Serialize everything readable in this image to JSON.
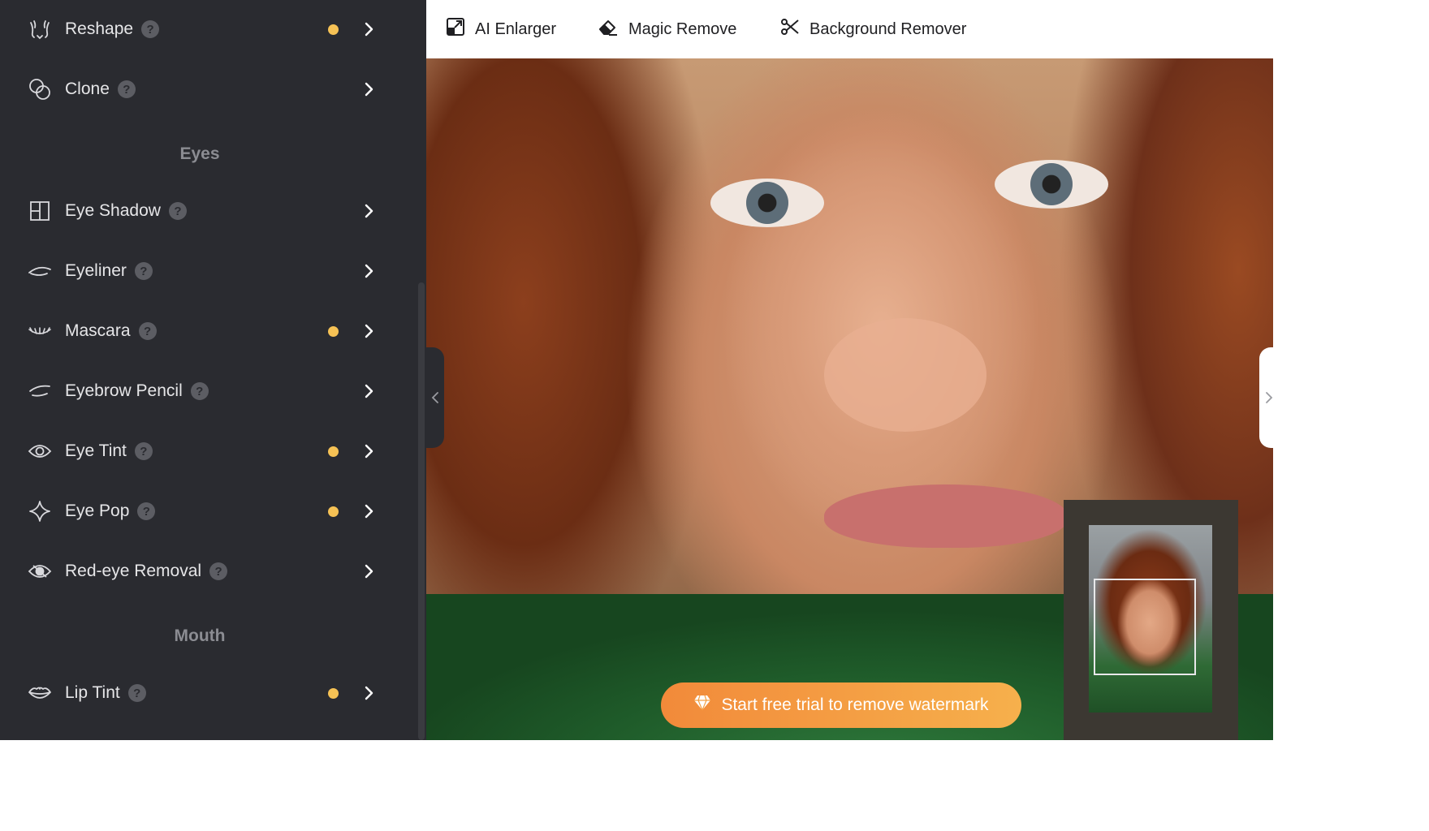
{
  "toolbar": {
    "ai_enlarger": "AI Enlarger",
    "magic_remove": "Magic Remove",
    "background_remover": "Background Remover"
  },
  "sidebar": {
    "items_top": [
      {
        "label": "Reshape",
        "icon": "reshape-icon",
        "dot": true
      },
      {
        "label": "Clone",
        "icon": "clone-icon",
        "dot": false
      }
    ],
    "section_eyes": "Eyes",
    "eyes_items": [
      {
        "label": "Eye Shadow",
        "icon": "eye-shadow-icon",
        "dot": false
      },
      {
        "label": "Eyeliner",
        "icon": "eyeliner-icon",
        "dot": false
      },
      {
        "label": "Mascara",
        "icon": "mascara-icon",
        "dot": true
      },
      {
        "label": "Eyebrow Pencil",
        "icon": "eyebrow-pencil-icon",
        "dot": false
      },
      {
        "label": "Eye Tint",
        "icon": "eye-tint-icon",
        "dot": true
      },
      {
        "label": "Eye Pop",
        "icon": "eye-pop-icon",
        "dot": true
      },
      {
        "label": "Red-eye Removal",
        "icon": "red-eye-removal-icon",
        "dot": false
      }
    ],
    "section_mouth": "Mouth",
    "mouth_items": [
      {
        "label": "Lip Tint",
        "icon": "lip-tint-icon",
        "dot": true
      }
    ],
    "help_glyph": "?"
  },
  "watermark": {
    "label": "Start free trial to remove watermark",
    "icon": "diamond-icon"
  },
  "colors": {
    "sidebar_bg": "#2a2b30",
    "dot": "#f6c255",
    "cta_start": "#f28a3a",
    "cta_end": "#f6b04c"
  }
}
